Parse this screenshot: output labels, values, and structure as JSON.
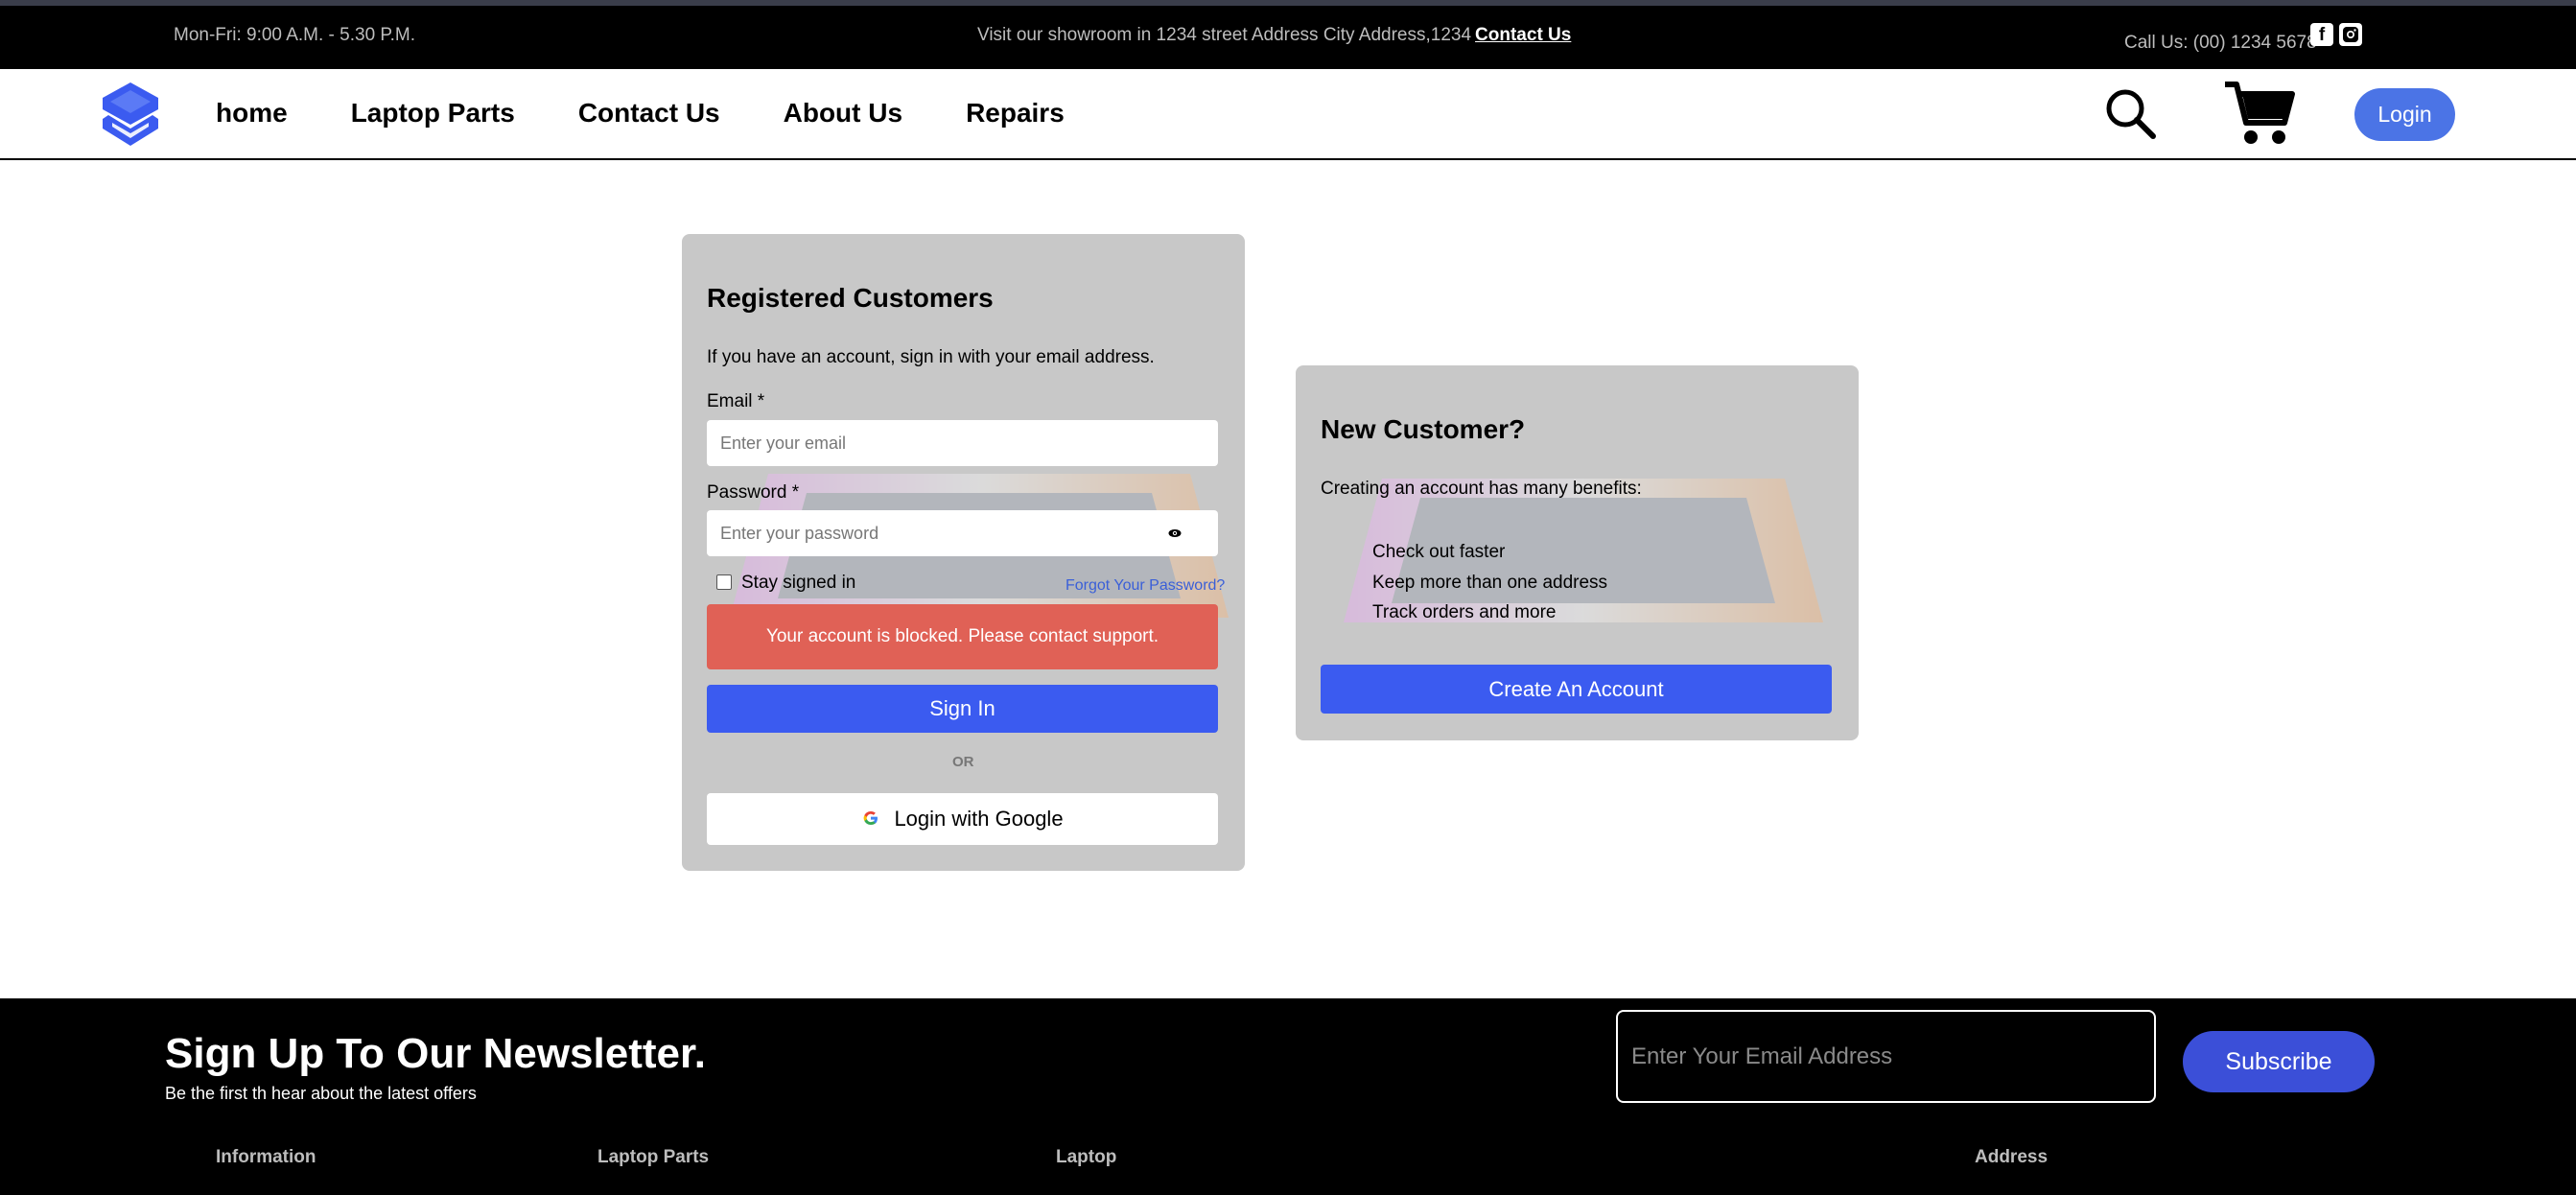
{
  "topbar": {
    "hours": "Mon-Fri: 9:00 A.M. - 5.30 P.M.",
    "visit": "Visit our showroom in 1234 street Address City Address,1234",
    "contact_link": "Contact Us",
    "call": "Call Us: (00) 1234 5678"
  },
  "nav": {
    "links": [
      "home",
      "Laptop Parts",
      "Contact Us",
      "About Us",
      "Repairs"
    ],
    "login_label": "Login"
  },
  "login_card": {
    "title": "Registered Customers",
    "intro": "If you have an account, sign in with your email address.",
    "email_label": "Email *",
    "email_placeholder": "Enter your email",
    "password_label": "Password *",
    "password_placeholder": "Enter your password",
    "stay_signed_in": "Stay signed in",
    "forgot": "Forgot Your Password?",
    "error": "Your account is blocked. Please contact support.",
    "sign_in": "Sign In",
    "or": "OR",
    "google": "Login with Google"
  },
  "new_card": {
    "title": "New Customer?",
    "intro": "Creating an account has many benefits:",
    "benefits": [
      "Check out faster",
      "Keep more than one address",
      "Track orders and more"
    ],
    "create": "Create An Account"
  },
  "footer": {
    "newsletter_title": "Sign Up To Our Newsletter.",
    "newsletter_sub": "Be the first th hear about the latest offers",
    "email_placeholder": "Enter Your Email Address",
    "subscribe": "Subscribe",
    "columns": [
      "Information",
      "Laptop Parts",
      "Laptop",
      "Address"
    ]
  },
  "colors": {
    "accent_blue": "#3b5bf0",
    "login_pill": "#4b74e6",
    "error_red": "#e06156",
    "card_grey": "#c8c8c8"
  }
}
